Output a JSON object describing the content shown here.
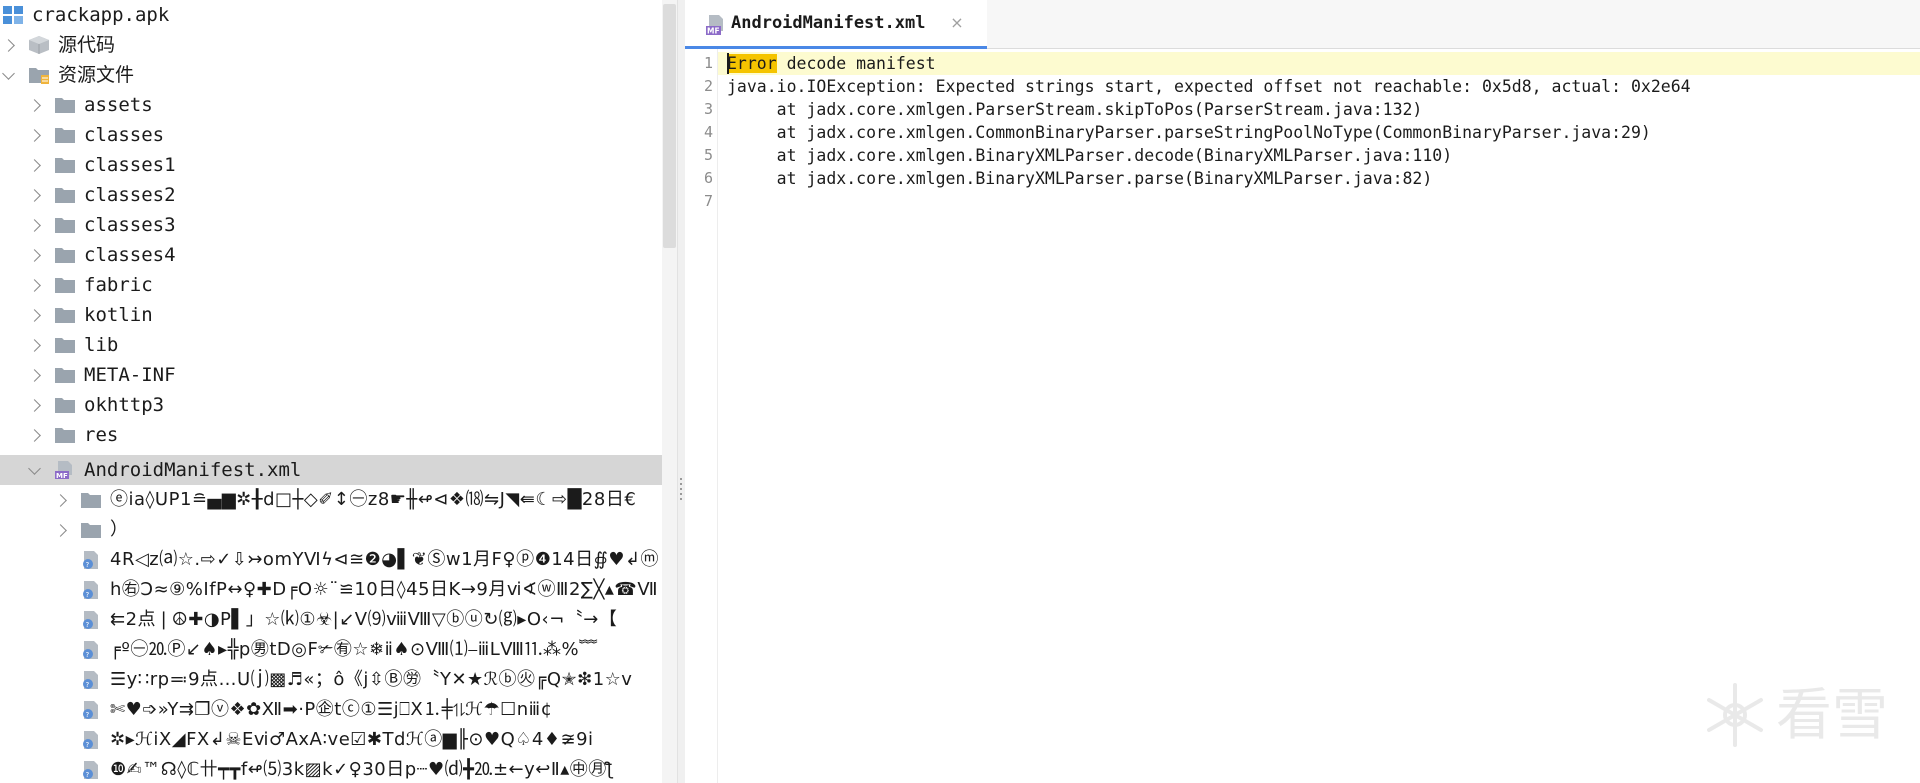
{
  "tree": {
    "root": "crackapp.apk",
    "source_code": "源代码",
    "resources": "资源文件",
    "folders": [
      "assets",
      "classes",
      "classes1",
      "classes2",
      "classes3",
      "classes4",
      "fabric",
      "kotlin",
      "lib",
      "META-INF",
      "okhttp3",
      "res"
    ],
    "manifest": "AndroidManifest.xml",
    "manifest_children": [
      {
        "type": "folder",
        "label": "ⓔia◊UP1≘▄▆✲╂d□┼◇✐↕㊀z8☛╫↫⊲❖⒅⇋J◥⇚☾⇨█28日€"
      },
      {
        "type": "folder",
        "label": "）"
      },
      {
        "type": "file",
        "label": "4R◁z⒜☆.⇨✓⇩↣omYⅥϟ⊲≅❷◕▌❦Ⓢw1月F♀ⓟ❹14日∯♥↲ⓜ"
      },
      {
        "type": "file",
        "label": "h㊨Ↄ≈⑨%IfP↔♀✚D╒O☼¨≌10日◊45日K→9月ⅵ∢ⓦⅢ2∑╳▴☎Ⅶ"
      },
      {
        "type": "file",
        "label": "⇇2点❘☮✚◑P▌」☆⒦①☣|↙V⑼ⅷⅧ▽ⓑⓤ↻⒢▸O‹¬〝→【"
      },
      {
        "type": "file",
        "label": "╒º㊀⒛Ⓟ↙♠▸╬p㊚tD◎F✃㊒☆❄ⅱ♠⊙Ⅷ⑴⎯ⅲLⅧ⒒⁂%﹌"
      },
      {
        "type": "file",
        "label": "☰y∷rp≕9点…U⒥▩♬«；ô《j⇳Ⓑ㊘〝Y✕★ℛⓑ㊋╔Q✭❇1☆ⅴ"
      },
      {
        "type": "file",
        "label": "✄♥➩»Y⇉❐ⓥ❖✿Ⅻ➡·P㊭tⓒ①☰j⎕Ⅹ⒈╪⥮ℋ☂☐nⅲ¢"
      },
      {
        "type": "file",
        "label": "✲▸ℋiⅩ◢FⅩ↲☠Eⅵ♂AxA∶ve☑✱Tdℋⓐ▆╟⊙♥Q♤4♦≆9i"
      },
      {
        "type": "file",
        "label": "❿✍™☊◊ℂ卄┯┳f↫⑸3k▨k✓♀30日p┈♥⒟╋⒛±←y↩Ⅱ▴㊥㊊ƪ"
      }
    ]
  },
  "tab": {
    "title": "AndroidManifest.xml",
    "close": "×",
    "icon_badge": "MF"
  },
  "editor": {
    "line_numbers": [
      "1",
      "2",
      "3",
      "4",
      "5",
      "6",
      "7"
    ],
    "error_word": "Error",
    "line1_rest": " decode manifest",
    "lines": [
      "java.io.IOException: Expected strings start, expected offset not reachable: 0x5d8, actual: 0x2e64",
      "     at jadx.core.xmlgen.ParserStream.skipToPos(ParserStream.java:132)",
      "     at jadx.core.xmlgen.CommonBinaryParser.parseStringPoolNoType(CommonBinaryParser.java:29)",
      "     at jadx.core.xmlgen.BinaryXMLParser.decode(BinaryXMLParser.java:110)",
      "     at jadx.core.xmlgen.BinaryXMLParser.parse(BinaryXMLParser.java:82)",
      ""
    ]
  },
  "watermark": {
    "text": "看雪"
  },
  "colors": {
    "selection": "#d6d6d6",
    "highlight_line": "#fdfbd0",
    "error_highlight": "#f5c400",
    "tab_underline": "#4a88e6",
    "folder": "#9aa4ae"
  }
}
